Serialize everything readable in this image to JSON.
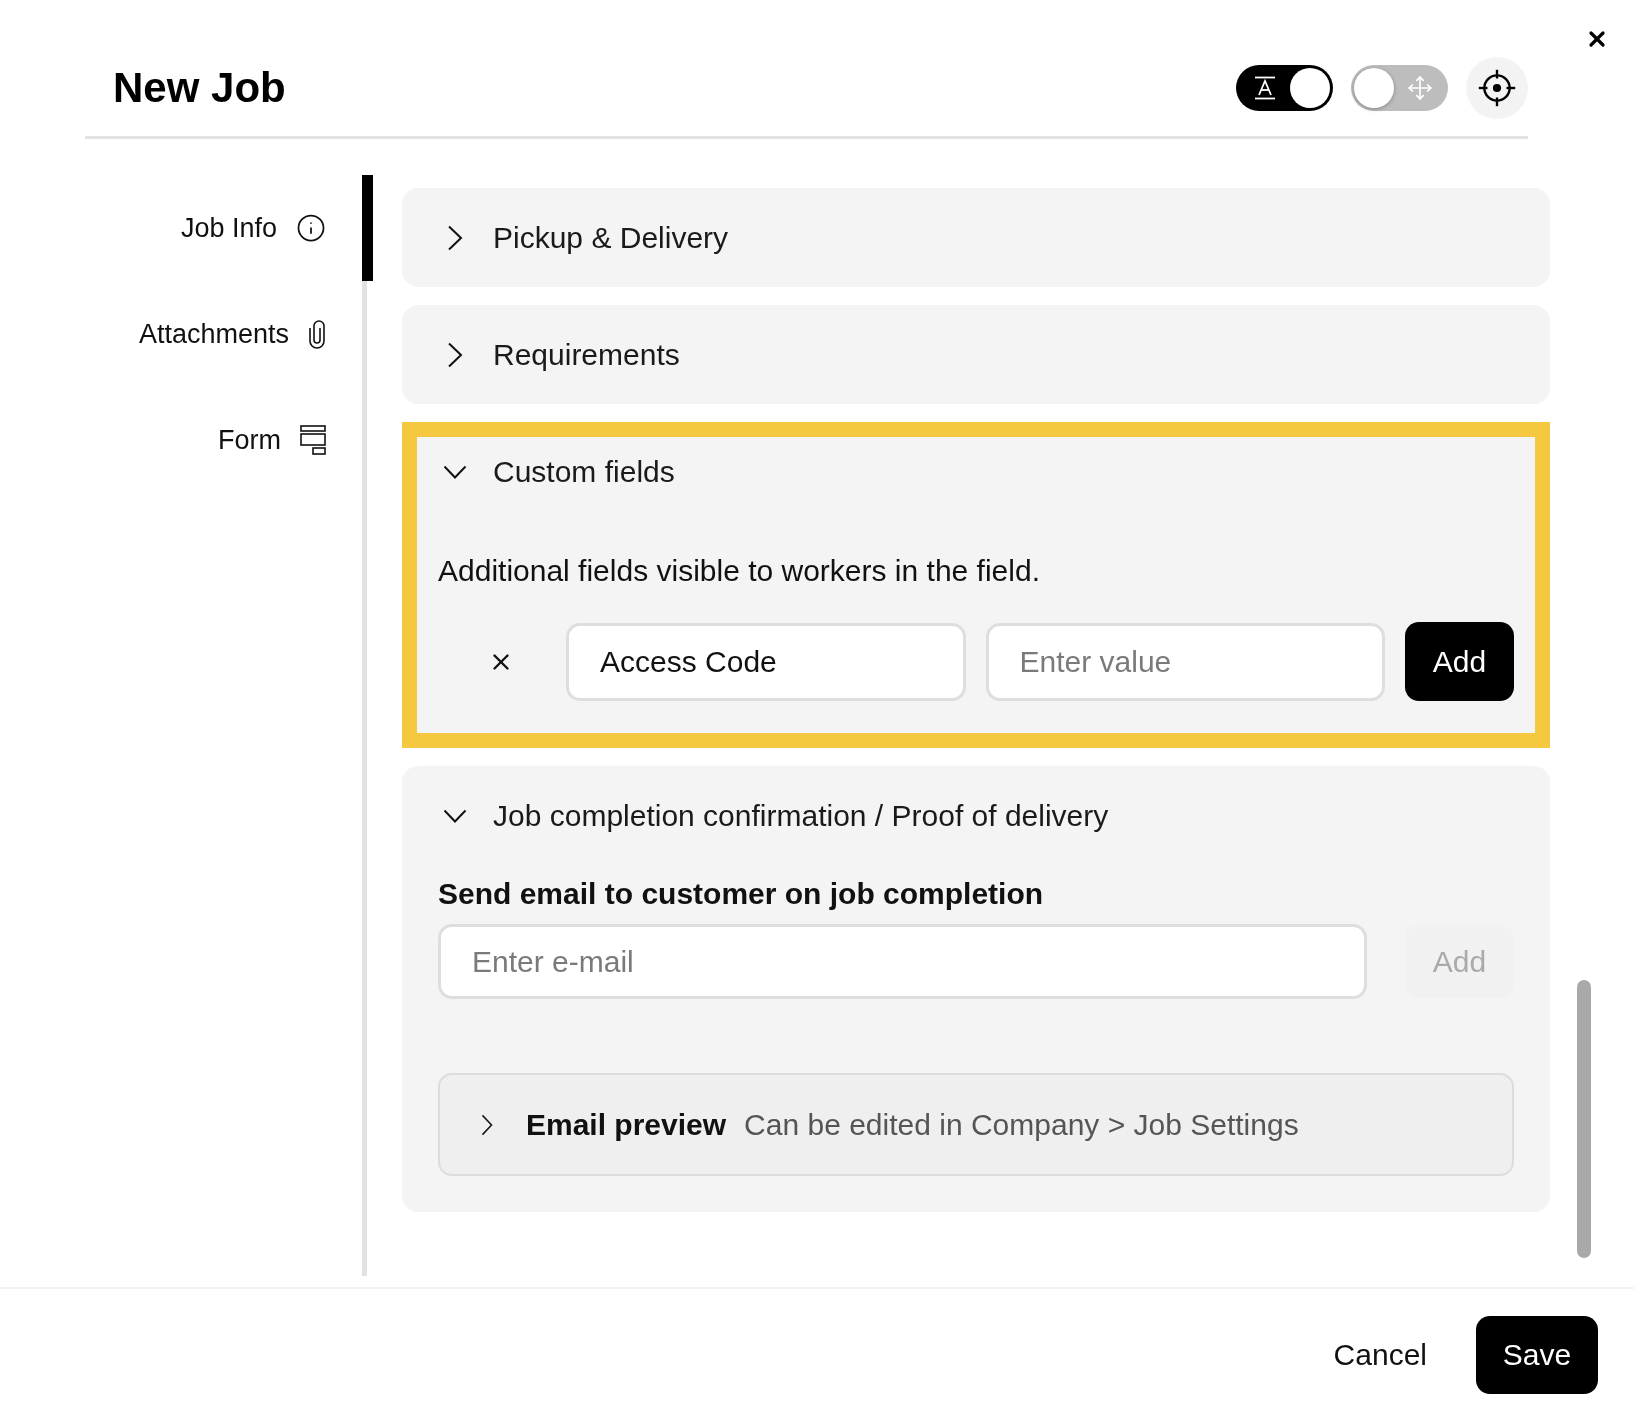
{
  "dialog": {
    "title": "New Job"
  },
  "header_toggles": [
    {
      "kind": "text",
      "on": true
    },
    {
      "kind": "move",
      "on": false
    }
  ],
  "sidebar": {
    "items": [
      {
        "label": "Job Info",
        "selected": true
      },
      {
        "label": "Attachments",
        "selected": false
      },
      {
        "label": "Form",
        "selected": false
      }
    ]
  },
  "sections": [
    {
      "kind": "basic",
      "title": "Pickup & Delivery",
      "expanded": false,
      "highlighted": false
    },
    {
      "kind": "basic",
      "title": "Requirements",
      "expanded": false,
      "highlighted": false
    },
    {
      "kind": "custom_fields",
      "title": "Custom fields",
      "expanded": true,
      "highlighted": true,
      "description": "Additional fields visible to workers in the field.",
      "field_name": "Access Code",
      "value_placeholder": "Enter value",
      "add_button": {
        "label": "Add",
        "disabled": false
      }
    },
    {
      "kind": "completion_email",
      "title": "Job completion confirmation / Proof of delivery",
      "expanded": true,
      "highlighted": false,
      "email_label": "Send email to customer on job completion",
      "email_placeholder": "Enter e-mail",
      "add_button": {
        "label": "Add",
        "disabled": true
      },
      "email_preview": {
        "title": "Email preview",
        "note": "Can be edited in Company > Job Settings",
        "expanded": false
      }
    }
  ],
  "footer": {
    "cancel": "Cancel",
    "save": "Save"
  }
}
